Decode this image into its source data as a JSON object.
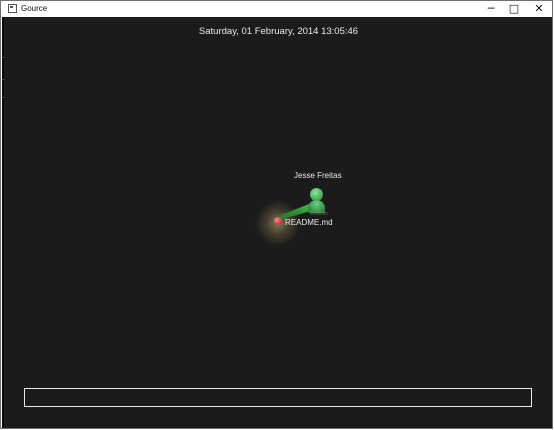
{
  "window": {
    "title": "Gource",
    "controls": {
      "minimize": "─",
      "maximize": "□",
      "close": "✕"
    }
  },
  "canvas": {
    "datetime": "Saturday, 01 February, 2014 13:05:46",
    "user": {
      "name": "Jesse Freitas",
      "color": "#4fbf5f",
      "icon": "user-avatar-icon"
    },
    "file": {
      "name": "README.md",
      "color": "#d24a4a",
      "icon": "file-node-icon"
    },
    "beam_color": "#3fcf3f",
    "background": "#1b1b1b"
  }
}
